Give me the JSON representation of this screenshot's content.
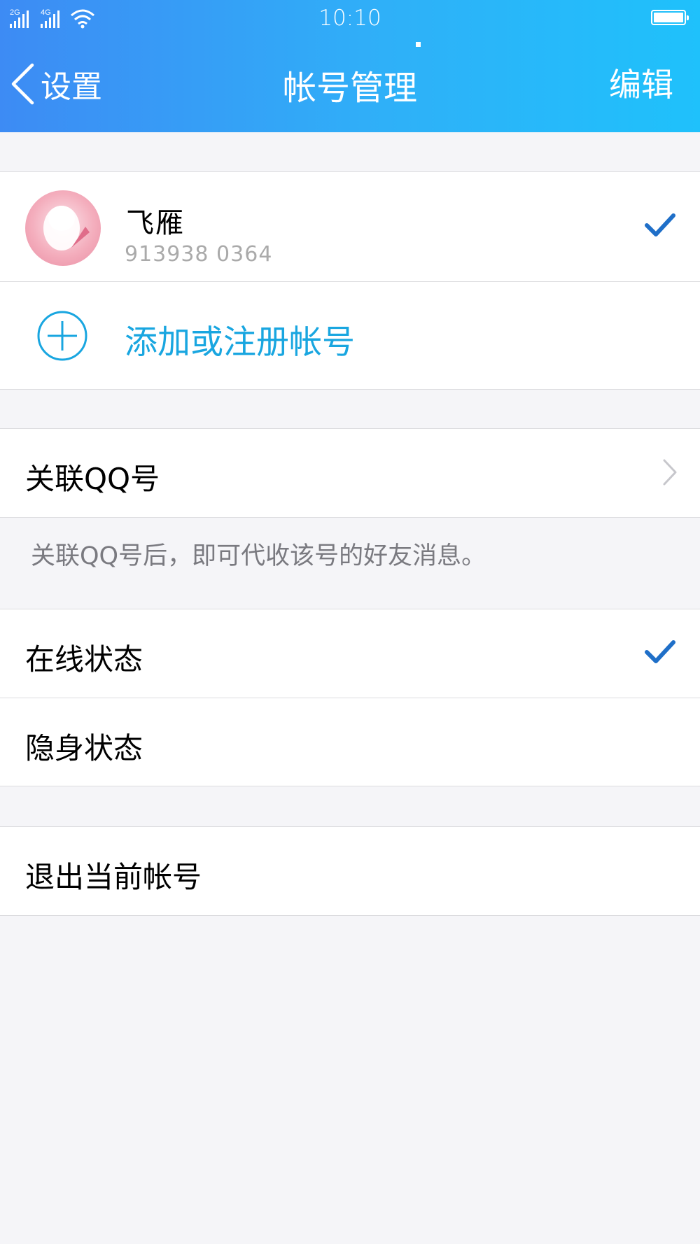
{
  "status_bar": {
    "signal_1": "2G",
    "signal_2": "4G",
    "time": "10:10"
  },
  "nav": {
    "back_label": "设置",
    "title": "帐号管理",
    "edit_label": "编辑"
  },
  "account": {
    "name": "飞雁",
    "id": "913938 0364",
    "selected": true
  },
  "add_account": {
    "label": "添加或注册帐号"
  },
  "link_qq": {
    "label": "关联QQ号",
    "hint": "关联QQ号后，即可代收该号的好友消息。"
  },
  "status_options": [
    {
      "label": "在线状态",
      "selected": true
    },
    {
      "label": "隐身状态",
      "selected": false
    }
  ],
  "logout": {
    "label": "退出当前帐号"
  },
  "colors": {
    "header_start": "#3d8bf4",
    "header_end": "#1fc1fb",
    "accent_blue": "#19a6e0",
    "check_blue": "#1f6fc8"
  }
}
